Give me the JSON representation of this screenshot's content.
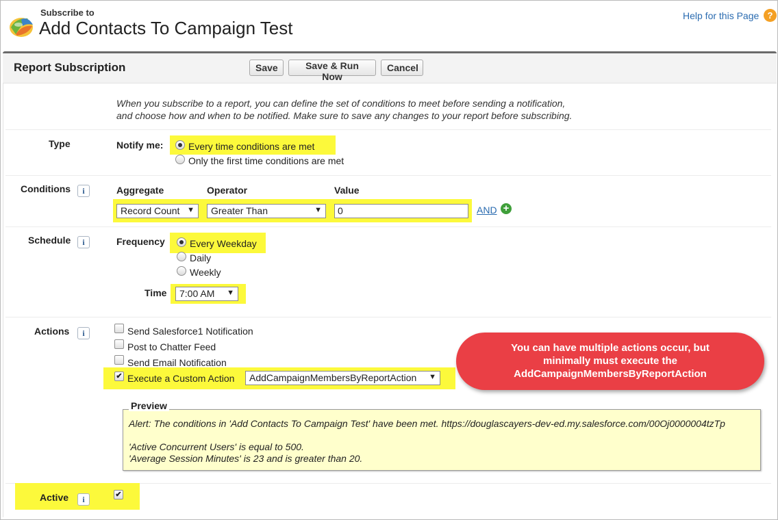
{
  "header": {
    "subtitle": "Subscribe to",
    "title": "Add Contacts To Campaign Test",
    "help_link": "Help for this Page",
    "help_icon": "help-icon"
  },
  "panel": {
    "title": "Report Subscription",
    "buttons": {
      "save": "Save",
      "save_run": "Save & Run Now",
      "cancel": "Cancel"
    }
  },
  "intro": {
    "line1": "When you subscribe to a report, you can define the set of conditions to meet before sending a notification,",
    "line2": "and choose how and when to be notified. Make sure to save any changes to your report before subscribing."
  },
  "type": {
    "label": "Type",
    "notify_label": "Notify me:",
    "options": [
      "Every time conditions are met",
      "Only the first time conditions are met"
    ],
    "selected": 0
  },
  "conditions": {
    "label": "Conditions",
    "headers": {
      "aggregate": "Aggregate",
      "operator": "Operator",
      "value": "Value"
    },
    "aggregate": "Record Count",
    "operator": "Greater Than",
    "value": "0",
    "and_link": "AND"
  },
  "schedule": {
    "label": "Schedule",
    "frequency_label": "Frequency",
    "options": [
      "Every Weekday",
      "Daily",
      "Weekly"
    ],
    "selected": 0,
    "time_label": "Time",
    "time": "7:00 AM"
  },
  "actions": {
    "label": "Actions",
    "items": [
      {
        "label": "Send Salesforce1 Notification",
        "checked": false
      },
      {
        "label": "Post to Chatter Feed",
        "checked": false
      },
      {
        "label": "Send Email Notification",
        "checked": false
      },
      {
        "label": "Execute a Custom Action",
        "checked": true
      }
    ],
    "custom_action": "AddCampaignMembersByReportAction"
  },
  "preview": {
    "legend": "Preview",
    "alert": "Alert: The conditions in 'Add Contacts To Campaign Test' have been met. https://douglascayers-dev-ed.my.salesforce.com/00Oj0000004tzTp",
    "line2": "'Active Concurrent Users' is equal to 500.",
    "line3": "'Average Session Minutes' is 23 and is greater than 20."
  },
  "active": {
    "label": "Active",
    "checked": true
  },
  "callout": {
    "line1": "You can have multiple actions occur, but",
    "line2": "minimally must execute the",
    "line3": "AddCampaignMembersByReportAction"
  },
  "colors": {
    "highlight": "#fcf93b",
    "callout": "#ea3f45",
    "link": "#2a6bb0",
    "preview_bg": "#ffffcc"
  }
}
